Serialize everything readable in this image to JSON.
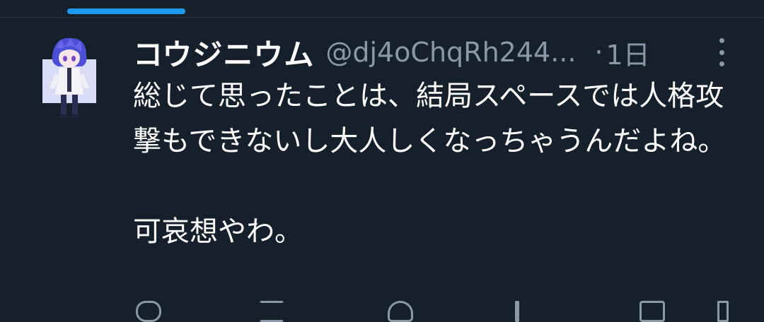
{
  "colors": {
    "background": "#15202b",
    "accent": "#1d9bf0",
    "secondary_text": "#8b98a5",
    "primary_text": "#ffffff"
  },
  "tweet": {
    "display_name": "コウジニウム",
    "handle": "@dj4oChqRh244...",
    "separator": "·",
    "time": "1日",
    "more_icon": "more-vertical-icon",
    "avatar_icon": "anime-character-avatar",
    "text_paragraph_1": "総じて思ったことは、結局スペースでは人格攻撃もできないし大人しくなっちゃうんだよね。",
    "text_paragraph_2": "可哀想やわ。"
  },
  "actions": {
    "icons": [
      "reply-icon",
      "retweet-icon",
      "like-icon",
      "views-icon",
      "bookmark-icon",
      "share-icon"
    ]
  }
}
